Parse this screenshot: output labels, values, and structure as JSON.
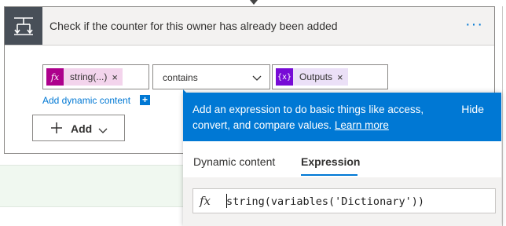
{
  "card": {
    "title": "Check if the counter for this owner has already been added",
    "more": "···"
  },
  "condition": {
    "left_token": {
      "label": "string(...)",
      "icon": "fx-icon",
      "color": "#ad008c",
      "bg": "#f3d4ec"
    },
    "operator": "contains",
    "right_token": {
      "label": "Outputs",
      "icon": "variable-braces-icon",
      "color": "#770bd6",
      "bg": "#ebe0f7"
    },
    "remove_glyph": "×",
    "add_dynamic_content": "Add dynamic content",
    "add_dynamic_plus": "+"
  },
  "add_button": {
    "label": "Add"
  },
  "panel": {
    "description": "Add an expression to do basic things like access, convert, and compare values.",
    "learn_more": "Learn more",
    "hide": "Hide",
    "tabs": [
      {
        "label": "Dynamic content",
        "active": false
      },
      {
        "label": "Expression",
        "active": true
      }
    ],
    "fx_label": "fx",
    "expression_value": "string(variables('Dictionary'))"
  },
  "colors": {
    "accent": "#0078d4",
    "header_bg": "#f3f2f1",
    "icon_box": "#484f58"
  }
}
